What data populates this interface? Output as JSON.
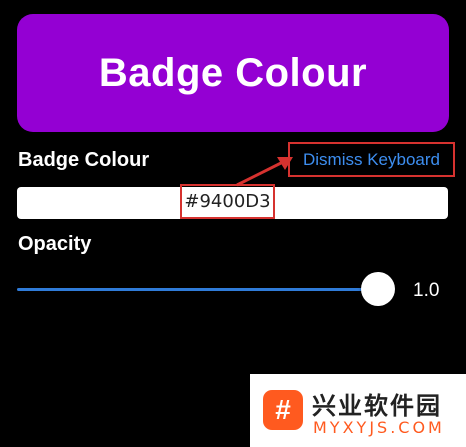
{
  "preview": {
    "text": "Badge Colour",
    "background": "#9400D3",
    "text_color": "#FFFFFF"
  },
  "colour_section": {
    "label": "Badge Colour",
    "dismiss_keyboard": "Dismiss Keyboard",
    "hex_value": "#9400D3"
  },
  "opacity_section": {
    "label": "Opacity",
    "value": 1.0,
    "value_text": "1.0",
    "min": 0,
    "max": 1
  },
  "watermark": {
    "logo_glyph": "#",
    "title": "兴业软件园",
    "url": "MYXYJS.COM"
  },
  "colors": {
    "accent_blue": "#3D8EF0",
    "slider_blue": "#2F7BD8",
    "annotation_red": "#D6322F",
    "background": "#000000"
  }
}
